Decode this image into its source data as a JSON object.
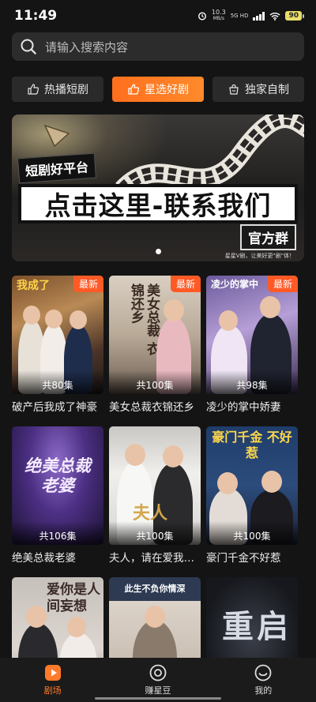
{
  "status_bar": {
    "time": "11:49",
    "net_speed_value": "10.3",
    "net_speed_unit": "MB/s",
    "network": "5G HD",
    "battery": "90"
  },
  "search": {
    "placeholder": "请输入搜索内容",
    "icon": "search-icon"
  },
  "tabs": [
    {
      "label": "热播短剧",
      "icon": "thumb-icon",
      "active": false
    },
    {
      "label": "星选好剧",
      "icon": "thumb-icon",
      "active": true
    },
    {
      "label": "独家自制",
      "icon": "bag-icon",
      "active": false
    }
  ],
  "banner": {
    "tag": "短剧好平台",
    "headline": "点击这里-联系我们",
    "sub": "官方群",
    "caption": "星星V剧，让美好更\"剧\"体！",
    "page_index": 1,
    "page_count": 1
  },
  "dramas": [
    {
      "title": "破产后我成了神豪",
      "episodes": "共80集",
      "badge": "最新",
      "poster_text": "我成了"
    },
    {
      "title": "美女总裁衣锦还乡",
      "episodes": "共100集",
      "badge": "最新",
      "poster_text": "美女总裁 衣锦还乡"
    },
    {
      "title": "凌少的掌中娇妻",
      "episodes": "共98集",
      "badge": "最新",
      "poster_text": "凌少的掌中"
    },
    {
      "title": "绝美总裁老婆",
      "episodes": "共106集",
      "badge": "",
      "poster_text": "绝美总裁老婆"
    },
    {
      "title": "夫人，请在爱我…",
      "episodes": "共100集",
      "badge": "",
      "poster_text": "夫人"
    },
    {
      "title": "豪门千金不好惹",
      "episodes": "共100集",
      "badge": "",
      "poster_text": "豪门千金 不好惹"
    },
    {
      "title": "",
      "episodes": "",
      "badge": "",
      "poster_text": "爱你是人间妄想"
    },
    {
      "title": "",
      "episodes": "",
      "badge": "",
      "poster_text": "此生不负你情深"
    },
    {
      "title": "",
      "episodes": "",
      "badge": "",
      "poster_text": "重启"
    }
  ],
  "bottom_nav": [
    {
      "label": "剧场",
      "icon": "play-icon",
      "active": true
    },
    {
      "label": "赚星豆",
      "icon": "coin-icon",
      "active": false
    },
    {
      "label": "我的",
      "icon": "smile-icon",
      "active": false
    }
  ],
  "colors": {
    "accent": "#ff7a2a",
    "background": "#141414",
    "badge": "#ff5a26"
  }
}
